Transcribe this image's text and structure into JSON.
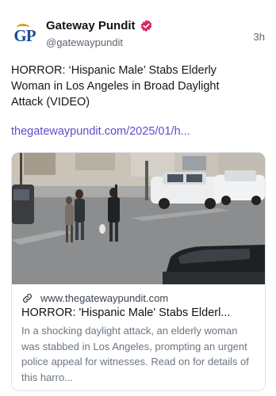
{
  "post": {
    "author": {
      "display_name": "Gateway Pundit",
      "handle": "@gatewaypundit",
      "avatar_text": "GP",
      "verified": true
    },
    "time": "3h",
    "text": "HORROR: ‘Hispanic Male’ Stabs Elderly Woman in Los Angeles in Broad Daylight Attack (VIDEO)",
    "link": "thegatewaypundit.com/2025/01/h..."
  },
  "card": {
    "domain": "www.thegatewaypundit.com",
    "title": "HORROR: 'Hispanic Male' Stabs Elderl...",
    "description": "In a shocking daylight attack, an elderly woman was stabbed in Los Angeles, prompting an urgent police appeal for witnesses. Read on for details of this harro..."
  },
  "icons": {
    "verified": "verified-badge-icon",
    "link": "link-icon"
  },
  "colors": {
    "link": "#5b4fc9",
    "verified": "#e0245e",
    "avatar_blue": "#1b4e9b",
    "avatar_gold": "#d9a21e"
  }
}
